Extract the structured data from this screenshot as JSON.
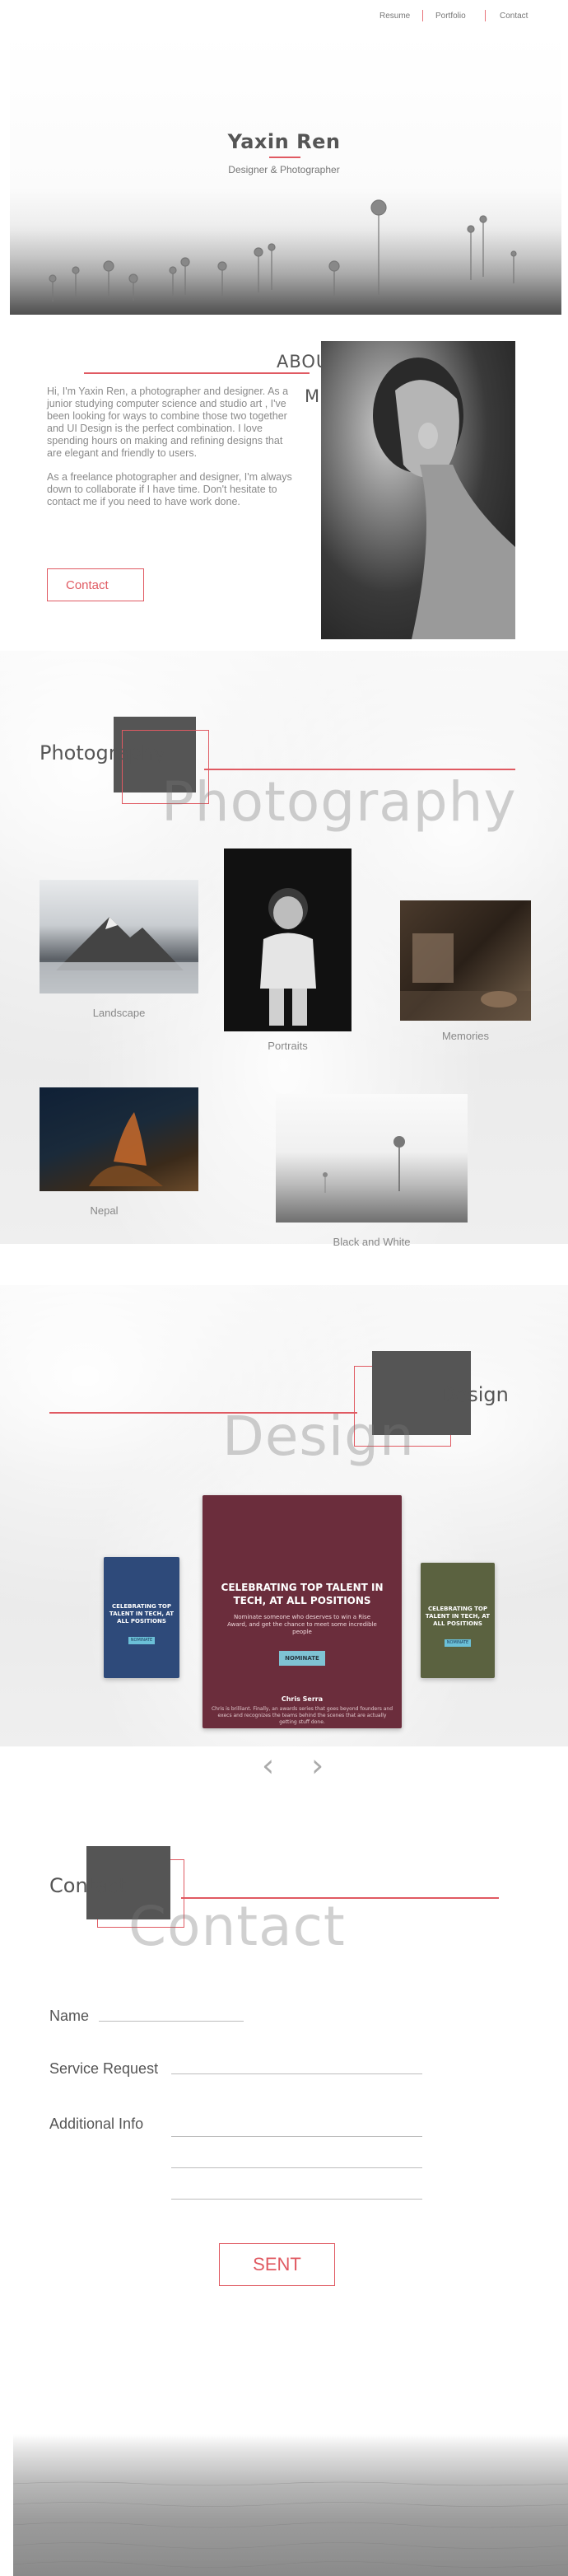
{
  "nav": {
    "links": [
      "Resume",
      "Portfolio",
      "Contact"
    ]
  },
  "hero": {
    "name": "Yaxin Ren",
    "subtitle": "Designer & Photographer",
    "image_icon": "palm-trees-landscape"
  },
  "about": {
    "title_line1": "ABOUT",
    "title_line2": "ME",
    "paragraph1": "Hi, I'm Yaxin Ren, a photographer and designer. As a junior studying computer science and studio art , I've been looking for ways to combine those two together and UI Design is the perfect combination. I love spending hours on making and refining designs that are elegant and friendly to users.",
    "paragraph2": "As a freelance photographer and designer, I'm always down to collaborate if I have time. Don't hesitate to contact me if you need to have work done.",
    "contact_button": "Contact"
  },
  "photography": {
    "label": "Photography",
    "ghost_label": "Photography",
    "items": [
      {
        "caption": "Landscape"
      },
      {
        "caption": "Portraits"
      },
      {
        "caption": "Memories"
      },
      {
        "caption": "Nepal"
      },
      {
        "caption": "Black and White"
      }
    ]
  },
  "design": {
    "label": "Design",
    "ghost_label": "Design",
    "posters": {
      "left": {
        "title": "CELEBRATING TOP TALENT IN TECH, AT ALL POSITIONS",
        "button": "NOMINATE",
        "color": "#2e4a7a"
      },
      "center": {
        "title": "CELEBRATING TOP TALENT IN TECH, AT ALL POSITIONS",
        "body": "Nominate someone who deserves to win a Rise Award, and get the chance to meet some incredible people",
        "button": "NOMINATE",
        "author": "Chris Serra",
        "quote": "Chris is brilliant. Finally, an awards series that goes beyond founders and execs and recognizes the teams behind the scenes that are actually getting stuff done.",
        "color": "#6b2d3c"
      },
      "right": {
        "title": "CELEBRATING TOP TALENT IN TECH, AT ALL POSITIONS",
        "button": "NOMINATE",
        "color": "#5b6240"
      }
    },
    "prev_arrow": "‹",
    "next_arrow": "›"
  },
  "contact": {
    "label": "Contact",
    "ghost_label": "Contact",
    "fields": {
      "name": "Name",
      "service": "Service Request",
      "additional": "Additional Info"
    },
    "send_button": "SENT"
  },
  "colors": {
    "accent": "#e05a62",
    "dark_box": "#555555",
    "text": "#555555"
  }
}
